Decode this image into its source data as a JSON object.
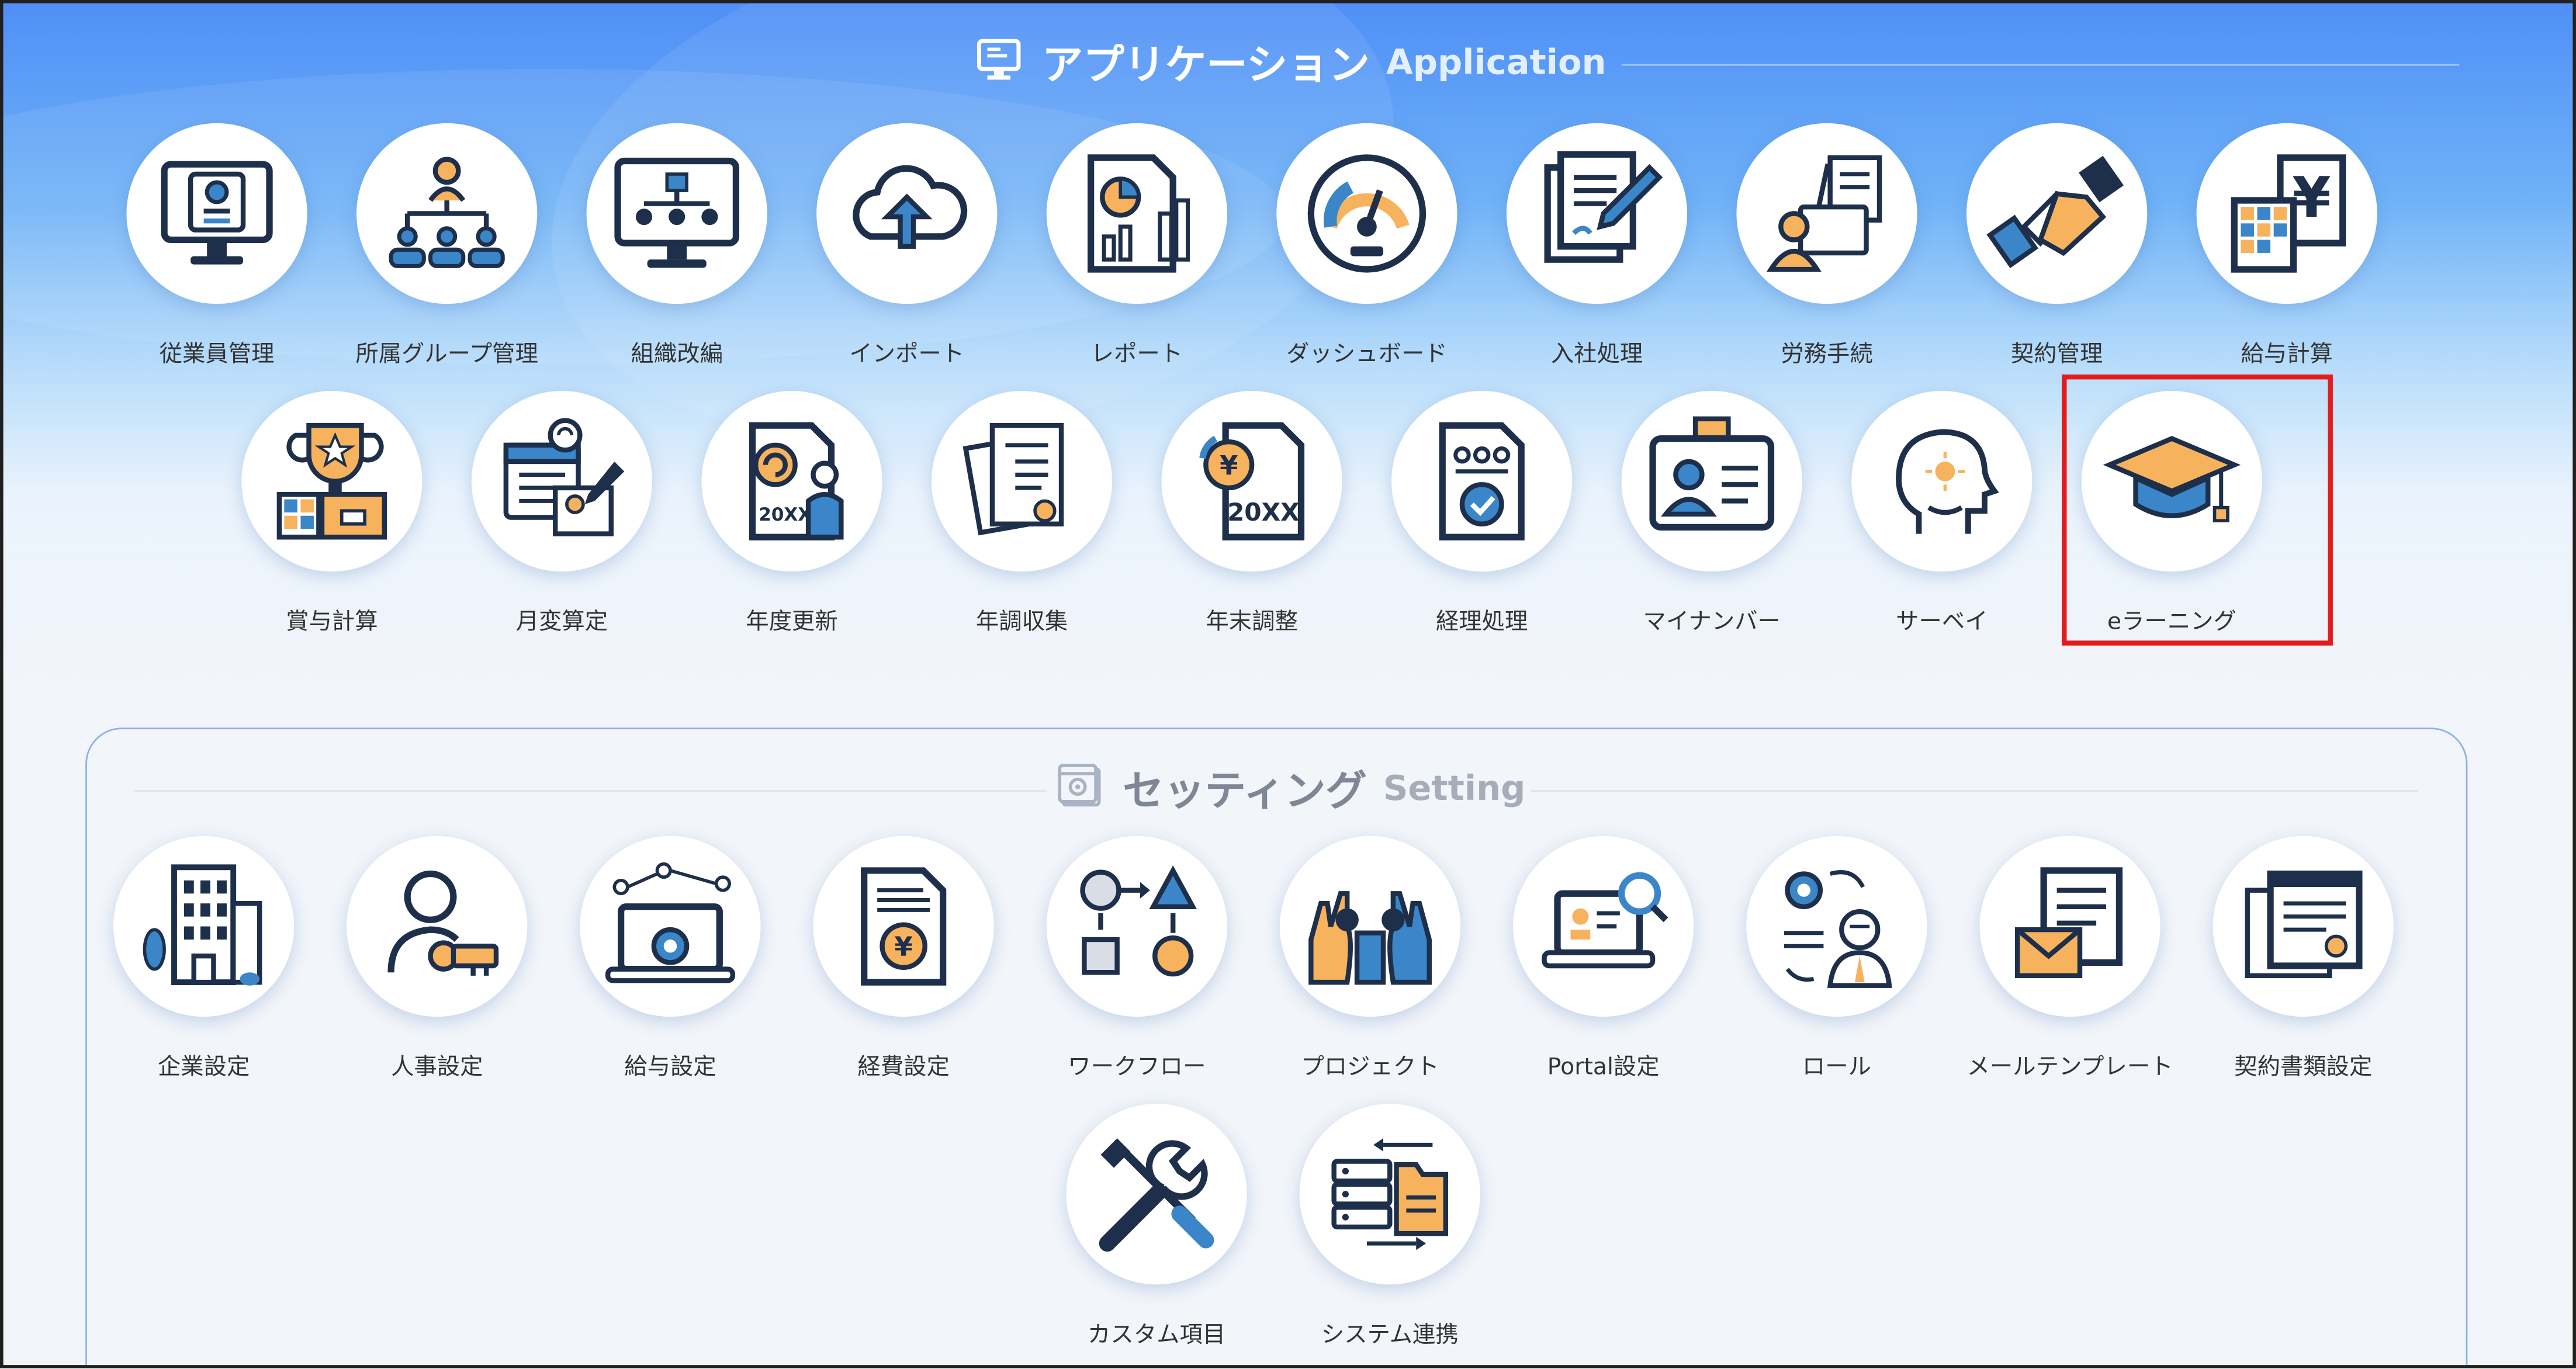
{
  "application": {
    "title_jp": "アプリケーション",
    "title_en": "Application",
    "icon": "monitor-icon",
    "items": [
      {
        "label": "従業員管理",
        "icon": "employee-card-monitor-icon"
      },
      {
        "label": "所属グループ管理",
        "icon": "org-group-icon"
      },
      {
        "label": "組織改編",
        "icon": "org-chart-monitor-icon"
      },
      {
        "label": "インポート",
        "icon": "cloud-upload-icon"
      },
      {
        "label": "レポート",
        "icon": "report-chart-icon"
      },
      {
        "label": "ダッシュボード",
        "icon": "gauge-icon"
      },
      {
        "label": "入社処理",
        "icon": "document-sign-icon"
      },
      {
        "label": "労務手続",
        "icon": "labor-procedure-icon"
      },
      {
        "label": "契約管理",
        "icon": "handshake-icon"
      },
      {
        "label": "給与計算",
        "icon": "yen-calculator-icon"
      },
      {
        "label": "賞与計算",
        "icon": "trophy-icon"
      },
      {
        "label": "月変算定",
        "icon": "calendar-calc-icon"
      },
      {
        "label": "年度更新",
        "icon": "year-update-icon"
      },
      {
        "label": "年調収集",
        "icon": "document-stack-icon"
      },
      {
        "label": "年末調整",
        "icon": "year-end-adjust-icon"
      },
      {
        "label": "経理処理",
        "icon": "accounting-check-icon"
      },
      {
        "label": "マイナンバー",
        "icon": "id-card-icon"
      },
      {
        "label": "サーベイ",
        "icon": "survey-head-icon"
      },
      {
        "label": "eラーニング",
        "icon": "graduation-cap-icon"
      }
    ]
  },
  "setting": {
    "title_jp": "セッティング",
    "title_en": "Setting",
    "icon": "settings-window-icon",
    "items": [
      {
        "label": "企業設定",
        "icon": "building-icon"
      },
      {
        "label": "人事設定",
        "icon": "person-key-icon"
      },
      {
        "label": "給与設定",
        "icon": "laptop-gear-icon"
      },
      {
        "label": "経費設定",
        "icon": "expense-document-icon"
      },
      {
        "label": "ワークフロー",
        "icon": "workflow-icon"
      },
      {
        "label": "プロジェクト",
        "icon": "team-icon"
      },
      {
        "label": "Portal設定",
        "icon": "laptop-search-icon"
      },
      {
        "label": "ロール",
        "icon": "role-gear-person-icon"
      },
      {
        "label": "メールテンプレート",
        "icon": "mail-template-icon"
      },
      {
        "label": "契約書類設定",
        "icon": "contract-docs-icon"
      },
      {
        "label": "カスタム項目",
        "icon": "tools-icon"
      },
      {
        "label": "システム連携",
        "icon": "system-integration-icon"
      }
    ]
  },
  "highlighted_item": "eラーニング",
  "colors": {
    "accent_red": "#e31b1b",
    "navy": "#1d2f4a",
    "orange": "#f7b25d",
    "blue": "#3a86c8"
  }
}
